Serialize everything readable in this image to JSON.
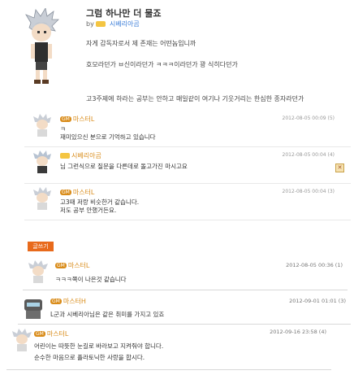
{
  "post": {
    "title": "그럼 하나만 더 물죠",
    "by": "by",
    "author": "시베리아곰",
    "lines": [
      "자게 감독자로서 제 존재는 어떤놈입니까",
      "호모라던가 ㅂ신이라던가 ㅋㅋㅋ이라던가 꽝 식히다던가",
      "고3주제에 하라는 공부는 안하고 매일같이 여기나 기웃거리는 한심한 종자라던가"
    ]
  },
  "comments": [
    {
      "badge": "GM",
      "author": "마스터L",
      "date": "2012-08-05 00:09 (5)",
      "lines": [
        "ㅋ",
        "재미있으신 분으로 기억하고 있습니다"
      ]
    },
    {
      "badge": "",
      "author": "시베리아곰",
      "date": "2012-08-05 00:04 (4)",
      "lines": [
        "님 그런식으로 질문을 다른데로 돌고가진 마시고요"
      ],
      "delete_icon": "close-icon"
    },
    {
      "badge": "GM",
      "author": "마스터L",
      "date": "2012-08-05 00:04 (3)",
      "lines": [
        "고3때 저랑 비슷한거 같습니다.",
        "저도 공부 안했거든요."
      ]
    }
  ],
  "write_button": "글쓰기",
  "replies": [
    {
      "badge": "GM",
      "author": "마스터L",
      "date": "2012-08-05 00:36 (1)",
      "lines": [
        "ㅋㅋㅋ쪽이 나은것 같습니다"
      ]
    },
    {
      "badge": "GM",
      "author": "마스터H",
      "date": "2012-09-01 01:01 (3)",
      "lines": [
        "L군과 시베리아님은 같은 취미를 가지고 있죠"
      ]
    },
    {
      "badge": "GM",
      "author": "마스터L",
      "date": "2012-09-16 23:58 (4)",
      "lines": [
        "어린이는 따뜻한 눈길로 바라보고 지켜줘야 합니다.",
        "순수한 마음으로 플라토닉한 사랑을 합시다."
      ]
    }
  ]
}
